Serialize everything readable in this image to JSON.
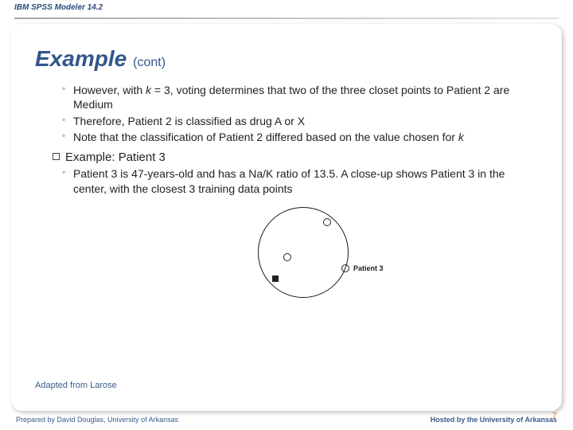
{
  "brand": "IBM SPSS Modeler 14.2",
  "title": {
    "main": "Example",
    "sub": "(cont)"
  },
  "bullets": {
    "sub1_a": "However, with ",
    "sub1_k": "k",
    "sub1_b": " = 3, voting determines that two of the three closet points to Patient 2 are Medium",
    "sub2": "Therefore, Patient 2 is classified as drug A or X",
    "sub3_a": "Note that the classification of Patient 2 differed based on the value chosen for ",
    "sub3_k": "k",
    "box": "Example: Patient 3",
    "sub4": "Patient 3 is 47-years-old and has a Na/K ratio of 13.5. A close-up shows Patient 3 in the center, with the closest 3 training data points"
  },
  "figure": {
    "label": "Patient 3"
  },
  "adapted": "Adapted from Larose",
  "footer": {
    "left": "Prepared by David Douglas, University of Arkansas",
    "right": "Hosted by the University of Arkansas"
  },
  "slide_number": "7"
}
